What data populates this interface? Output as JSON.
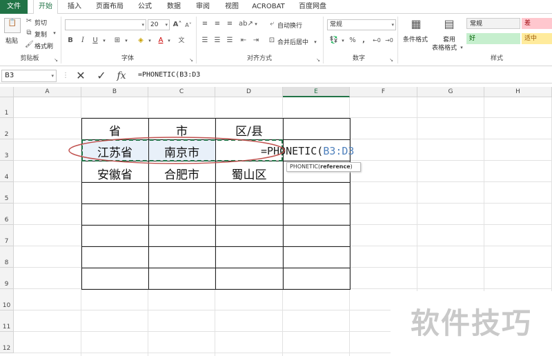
{
  "menu": {
    "tabs": [
      "文件",
      "开始",
      "插入",
      "页面布局",
      "公式",
      "数据",
      "审阅",
      "视图",
      "ACROBAT",
      "百度网盘"
    ],
    "active": "开始"
  },
  "ribbon": {
    "clipboard": {
      "paste": "粘贴",
      "cut": "剪切",
      "copy": "复制",
      "format_painter": "格式刷",
      "label": "剪贴板"
    },
    "font": {
      "size": "20",
      "bold": "B",
      "italic": "I",
      "underline": "U",
      "label": "字体",
      "grow": "A",
      "shrink": "A"
    },
    "alignment": {
      "wrap": "自动换行",
      "merge": "合并后居中",
      "label": "对齐方式"
    },
    "number": {
      "format": "常规",
      "percent": "%",
      "comma": ",",
      "label": "数字"
    },
    "styles": {
      "conditional": "条件格式",
      "table_line1": "套用",
      "table_line2": "表格格式",
      "normal": "常规",
      "bad": "差",
      "good": "好",
      "neutral": "适中",
      "label": "样式"
    }
  },
  "formula_bar": {
    "name_box": "B3",
    "formula": "=PHONETIC(B3:D3"
  },
  "columns": [
    "A",
    "B",
    "C",
    "D",
    "E",
    "F",
    "G",
    "H"
  ],
  "selected_column": "E",
  "rows": [
    "1",
    "2",
    "3",
    "4",
    "5",
    "6",
    "7",
    "8",
    "9",
    "10",
    "11",
    "12"
  ],
  "table": {
    "header": [
      "省",
      "市",
      "区/县"
    ],
    "row3": [
      "江苏省",
      "南京市"
    ],
    "row4": [
      "安徽省",
      "合肥市",
      "蜀山区"
    ]
  },
  "editing": {
    "prefix": "=PHONETIC(",
    "ref": "B3:D3"
  },
  "tooltip": {
    "func": "PHONETIC(",
    "arg": "reference",
    ")": ")"
  },
  "tooltip_close": ")",
  "watermark": "软件技巧",
  "colors": {
    "accent": "#217346",
    "selection": "#5b9bd5",
    "ellipse": "#c0504d"
  }
}
